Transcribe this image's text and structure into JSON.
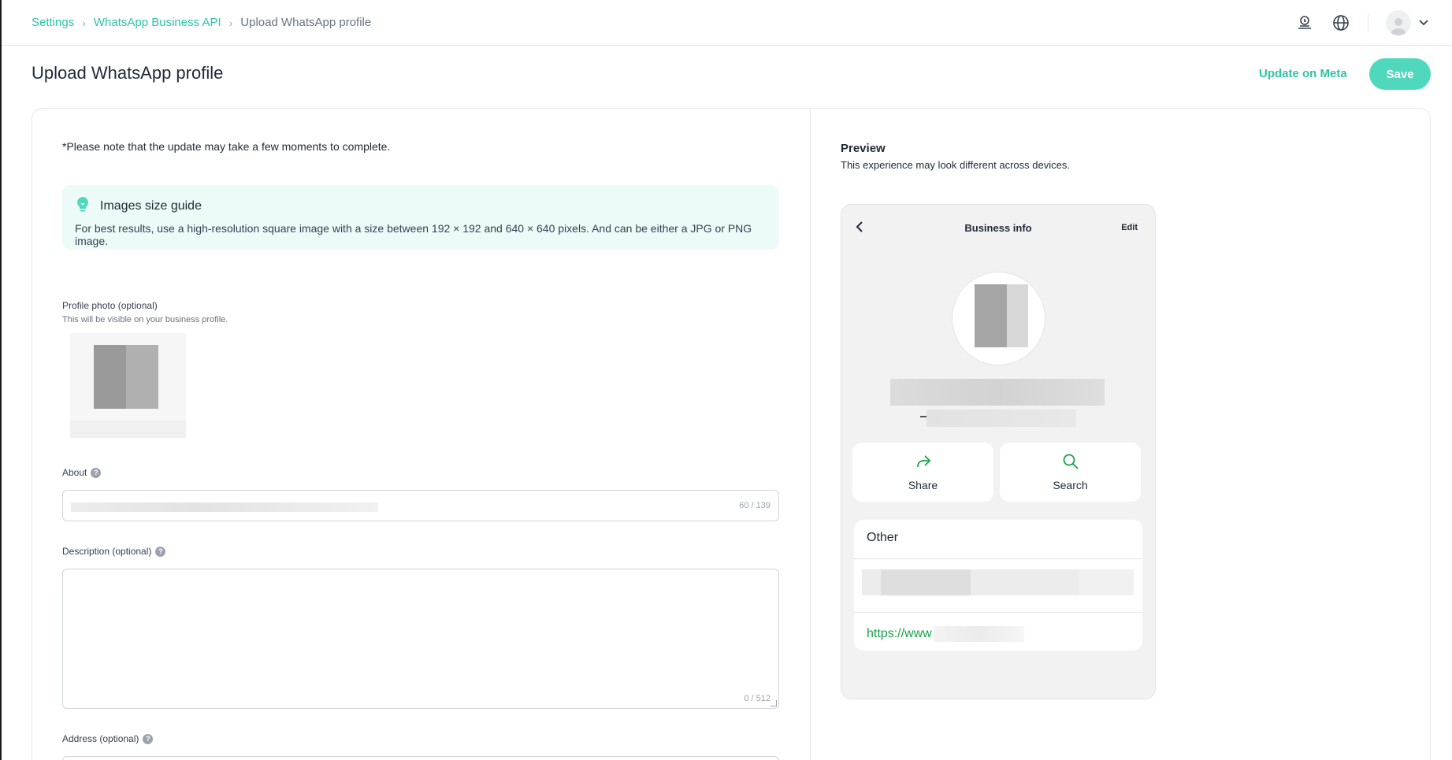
{
  "breadcrumb": {
    "items": [
      {
        "label": "Settings"
      },
      {
        "label": "WhatsApp Business API"
      }
    ],
    "current": "Upload WhatsApp profile"
  },
  "header": {
    "title": "Upload WhatsApp profile",
    "update_label": "Update on Meta",
    "save_label": "Save"
  },
  "form": {
    "note": "*Please note that the update may take a few moments to complete.",
    "guide": {
      "title": "Images size guide",
      "text": "For best results, use a high-resolution square image with a size between 192 × 192 and 640 × 640 pixels. And can be either a JPG or PNG image."
    },
    "profile_photo": {
      "label": "Profile photo (optional)",
      "hint": "This will be visible on your business profile."
    },
    "about": {
      "label": "About",
      "counter": "60 / 139"
    },
    "description": {
      "label": "Description (optional)",
      "counter": "0 / 512"
    },
    "address": {
      "label": "Address (optional)"
    }
  },
  "preview": {
    "title": "Preview",
    "subtitle": "This experience may look different across devices.",
    "phone": {
      "title": "Business info",
      "edit": "Edit",
      "share": "Share",
      "search": "Search",
      "other": "Other",
      "link_prefix": "https://www"
    }
  },
  "colors": {
    "accent": "#2ec4a6",
    "save_bg": "#4fd8bc",
    "guide_bg": "#ecfbf7",
    "link": "#16a34a"
  }
}
